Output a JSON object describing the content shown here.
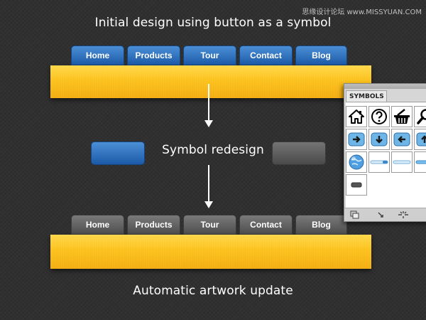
{
  "top_heading": "Initial design using button as a symbol",
  "middle_label": "Symbol redesign",
  "bottom_heading": "Automatic artwork update",
  "watermark": "思缘设计论坛 www.MISSYUAN.COM",
  "nav_top": {
    "items": [
      "Home",
      "Products",
      "Tour",
      "Contact",
      "Blog"
    ]
  },
  "nav_bottom": {
    "items": [
      "Home",
      "Products",
      "Tour",
      "Contact",
      "Blog"
    ]
  },
  "symbols_panel": {
    "tab_label": "SYMBOLS"
  },
  "colors": {
    "blue_button": "#1c5aa8",
    "gray_button": "#4e4e4e",
    "yellow_bar": "#fcc21c",
    "background": "#303030"
  }
}
